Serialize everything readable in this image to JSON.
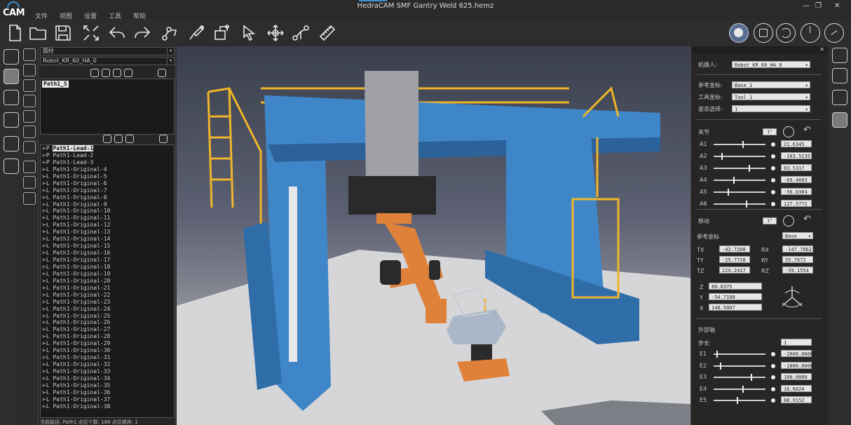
{
  "app": {
    "logo": "CAM",
    "window_title": "HedraCAM SMF  Gantry Weld 625.hemz"
  },
  "menu": [
    "文件",
    "视图",
    "设置",
    "工具",
    "帮助"
  ],
  "window_controls": {
    "minimize": "—",
    "maximize": "❐",
    "close": "✕"
  },
  "toolbar_icons": [
    "new-file-icon",
    "open-folder-icon",
    "save-icon",
    "fit-view-icon",
    "undo-icon",
    "redo-icon",
    "robot-path-icon",
    "weld-torch-icon",
    "robot-frame-icon",
    "select-pointer-icon",
    "move-icon",
    "robot-teach-icon",
    "ruler-icon"
  ],
  "view_buttons": [
    "view-mode-1",
    "view-mode-2",
    "view-mode-3",
    "view-mode-4",
    "view-mode-5"
  ],
  "left_panel": {
    "object_combo": "圆柱",
    "robot_combo": "Robot_KR_60_HA_0",
    "path_name": "Path1_S",
    "tree": [
      "Path1-Lead-1",
      "Path1-Lead-2",
      "Path1-Lead-3",
      "Path1-Original-4",
      "Path1-Original-5",
      "Path1-Original-6",
      "Path1-Original-7",
      "Path1-Original-8",
      "Path1-Original-9",
      "Path1-Original-10",
      "Path1-Original-11",
      "Path1-Original-12",
      "Path1-Original-13",
      "Path1-Original-14",
      "Path1-Original-15",
      "Path1-Original-16",
      "Path1-Original-17",
      "Path1-Original-18",
      "Path1-Original-19",
      "Path1-Original-20",
      "Path1-Original-21",
      "Path1-Original-22",
      "Path1-Original-23",
      "Path1-Original-24",
      "Path1-Original-25",
      "Path1-Original-26",
      "Path1-Original-27",
      "Path1-Original-28",
      "Path1-Original-29",
      "Path1-Original-30",
      "Path1-Original-31",
      "Path1-Original-32",
      "Path1-Original-33",
      "Path1-Original-34",
      "Path1-Original-35",
      "Path1-Original-36",
      "Path1-Original-37",
      "Path1-Original-38"
    ],
    "status": "当前路径: Path1   点位个数: 186   点位顺序: 1"
  },
  "right_panel": {
    "robot_label": "机器人:",
    "robot_value": "Robot_KR_60_HA_0",
    "ref_frame_label": "参考坐标:",
    "ref_frame_value": "Base_1",
    "tool_frame_label": "工具坐标:",
    "tool_frame_value": "Tool_1",
    "config_label": "姿态选择:",
    "config_value": "1",
    "joints_title": "关节",
    "joints_unit": "1°",
    "joints": [
      {
        "name": "A1",
        "value": "21.6345",
        "pos": 0.55
      },
      {
        "name": "A2",
        "value": "-103.5135",
        "pos": 0.15
      },
      {
        "name": "A3",
        "value": "83.5317",
        "pos": 0.68
      },
      {
        "name": "A4",
        "value": "-69.4603",
        "pos": 0.38
      },
      {
        "name": "A5",
        "value": "-56.0304",
        "pos": 0.27
      },
      {
        "name": "A6",
        "value": "127.5772",
        "pos": 0.62
      }
    ],
    "move_title": "移动",
    "move_unit": "1°",
    "move_ref_label": "参考坐标",
    "move_ref_value": "Base",
    "tx": {
      "label": "TX",
      "value": "-42.7200"
    },
    "ty": {
      "label": "TY",
      "value": "-25.7728"
    },
    "tz": {
      "label": "TZ",
      "value": "229.2417"
    },
    "rx": {
      "label": "RX",
      "value": "-147.7862"
    },
    "ry": {
      "label": "RY",
      "value": "55.7672"
    },
    "rz": {
      "label": "RZ",
      "value": "-59.1554"
    },
    "z": {
      "label": "Z",
      "value": "80.0375"
    },
    "y": {
      "label": "Y",
      "value": "-54.7108"
    },
    "x": {
      "label": "X",
      "value": "148.5007"
    },
    "ext_title": "外部轴",
    "step_label": "步长",
    "step_value": "1",
    "ext_axes": [
      {
        "name": "E1",
        "value": "-2000.0000",
        "pos": 0.05
      },
      {
        "name": "E2",
        "value": "-1000.0000",
        "pos": 0.12
      },
      {
        "name": "E3",
        "value": "100.0000",
        "pos": 0.72
      },
      {
        "name": "E4",
        "value": "16.6024",
        "pos": 0.55
      },
      {
        "name": "E5",
        "value": "88.9152",
        "pos": 0.45
      }
    ]
  },
  "colors": {
    "gantry": "#3f86c8",
    "rails": "#f0b52a",
    "robot": "#e0813a",
    "positioner": "#a9b7c9"
  }
}
